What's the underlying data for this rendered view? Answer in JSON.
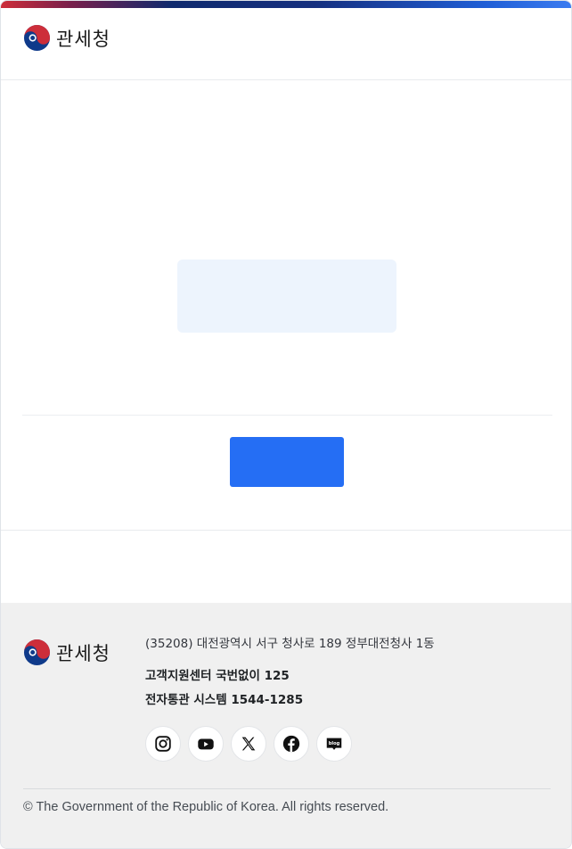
{
  "brand": {
    "logo_text": "관세청",
    "colors": {
      "red": "#cd2e3a",
      "blue": "#0f3a8a",
      "primary": "#256ef4"
    }
  },
  "main": {
    "primary_button_label": ""
  },
  "footer": {
    "address": "(35208) 대전광역시 서구 청사로 189 정부대전청사 1동",
    "customer_center": "고객지원센터 국번없이 125",
    "customs_system": "전자통관 시스템 1544-1285",
    "social": [
      "instagram-icon",
      "youtube-icon",
      "x-icon",
      "facebook-icon",
      "blog-icon"
    ],
    "copyright": "© The Government of the Republic of Korea. All rights reserved."
  }
}
